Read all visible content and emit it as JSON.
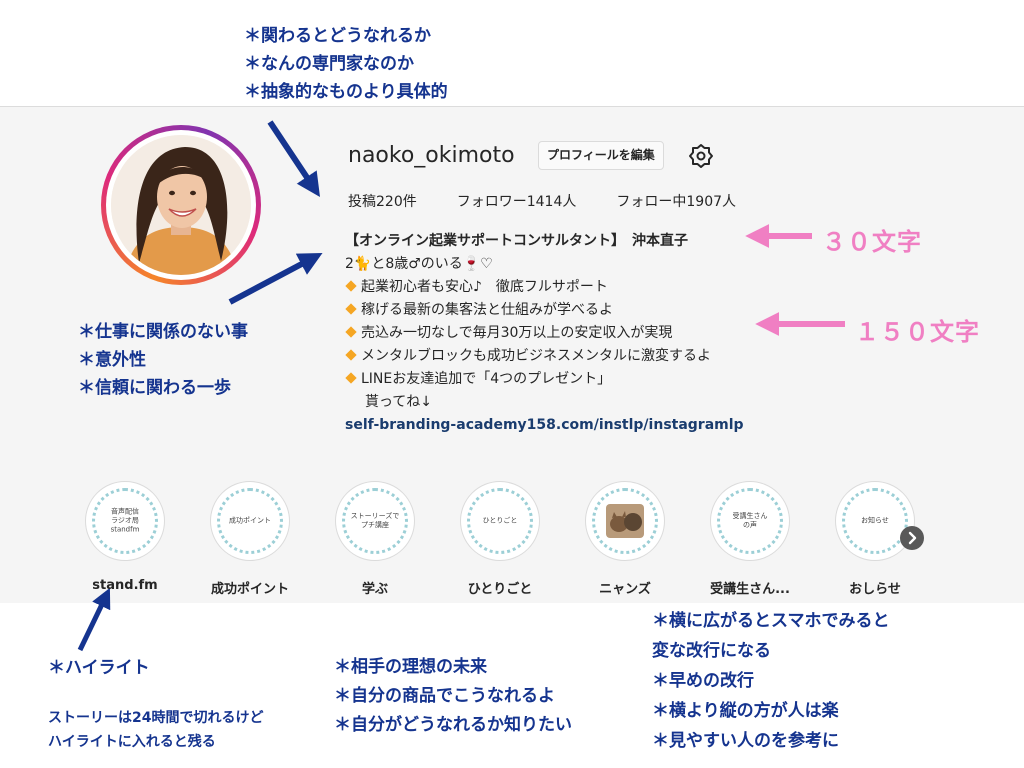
{
  "annotations": {
    "top": [
      "＊関わるとどうなれるか",
      "＊なんの専門家なのか",
      "＊抽象的なものより具体的"
    ],
    "left": [
      "＊仕事に関係のない事",
      "＊意外性",
      "＊信頼に関わる一歩"
    ],
    "highlight_title": "＊ハイライト",
    "highlight_note": [
      "ストーリーは24時間で切れるけど",
      "ハイライトに入れると残る"
    ],
    "middle": [
      "＊相手の理想の未来",
      "＊自分の商品でこうなれるよ",
      "＊自分がどうなれるか知りたい"
    ],
    "right": [
      "＊横に広がるとスマホでみると",
      "変な改行になる",
      "＊早めの改行",
      "＊横より縦の方が人は楽",
      "＊見やすい人のを参考に"
    ],
    "char30": "３０文字",
    "char150": "１５０文字"
  },
  "profile": {
    "username": "naoko_okimoto",
    "edit_button": "プロフィールを編集",
    "stats": [
      "投稿220件",
      "フォロワー1414人",
      "フォロー中1907人"
    ]
  },
  "bio": {
    "title": "【オンライン起業サポートコンサルタント】　沖本直子",
    "line2": "2🐈と8歳♂のいる🍷♡",
    "items": [
      "起業初心者も安心♪　徹底フルサポート",
      "稼げる最新の集客法と仕組みが学べるよ",
      "売込み一切なしで毎月30万以上の安定収入が実現",
      "メンタルブロックも成功ビジネスメンタルに激変するよ",
      "LINEお友達追加で「4つのプレゼント」"
    ],
    "cont": "貰ってね↓",
    "link": "self-branding-academy158.com/instlp/instagramlp"
  },
  "highlights": [
    {
      "label": "stand.fm",
      "cover": "音声配信\nラジオ局\nstandfm"
    },
    {
      "label": "成功ポイント",
      "cover": "成功ポイント"
    },
    {
      "label": "学ぶ",
      "cover": "ストーリーズで\nプチ講座"
    },
    {
      "label": "ひとりごと",
      "cover": "ひとりごと"
    },
    {
      "label": "ニャンズ",
      "cover": ""
    },
    {
      "label": "受講生さん...",
      "cover": "受講生さん\nの声"
    },
    {
      "label": "おしらせ",
      "cover": "お知らせ"
    }
  ],
  "icons": {
    "settings": "gear-icon",
    "next": "chevron-right-icon"
  },
  "colors": {
    "annotation": "#15348f",
    "pink": "#f07fc3",
    "link": "#1a3c6e"
  }
}
